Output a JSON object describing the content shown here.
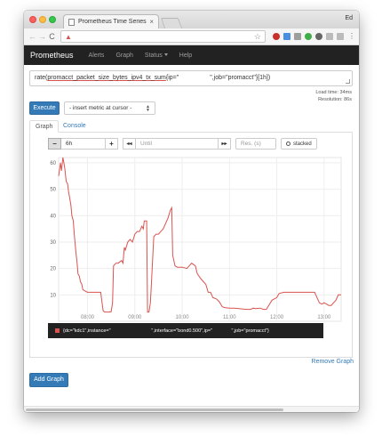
{
  "browser": {
    "tab_title": "Prometheus Time Series Colle",
    "tab_close": "×",
    "profile_name": "Ed",
    "nav": {
      "back": "←",
      "forward": "→",
      "reload": "C"
    },
    "security_icon": "warning-icon",
    "bookmark_icon": "star-icon"
  },
  "navbar": {
    "brand": "Prometheus",
    "links": [
      "Alerts",
      "Graph",
      "Status",
      "Help"
    ]
  },
  "query": {
    "expr_prefix": "rate(",
    "expr_metric": "promacct_packet_size_bytes_ipv4_tx_sum",
    "expr_label_start": "{ip=\"",
    "expr_gap": "                  ",
    "expr_suffix": "\",job=\"promacct\"}[1h])",
    "load_time": "Load time: 34ms",
    "resolution": "Resolution: 86s"
  },
  "actions": {
    "execute": "Execute",
    "metric_select": "- insert metric at cursor -",
    "remove_graph": "Remove Graph",
    "add_graph": "Add Graph"
  },
  "tabs": {
    "graph": "Graph",
    "console": "Console"
  },
  "controls": {
    "minus": "−",
    "range": "6h",
    "plus": "+",
    "back": "◂◂",
    "until_placeholder": "Until",
    "forward": "▸▸",
    "res_placeholder": "Res. (s)",
    "stacked": "stacked"
  },
  "legend": {
    "text": "{dc=\"kdc1\",instance=\"                              \",interface=\"bond0.500\",ip=\"              \",job=\"promacct\"}"
  },
  "colors": {
    "series": "#d9534f",
    "primary": "#337ab7",
    "navbar": "#222222"
  },
  "chart_data": {
    "type": "line",
    "title": "",
    "xlabel": "",
    "ylabel": "",
    "ylim": [
      0,
      62
    ],
    "yticks": [
      10,
      20,
      30,
      40,
      50,
      60
    ],
    "xlim": [
      7.39,
      13.36
    ],
    "xticks": [
      {
        "value": 8,
        "label": "08:00"
      },
      {
        "value": 9,
        "label": "09:00"
      },
      {
        "value": 10,
        "label": "10:00"
      },
      {
        "value": 11,
        "label": "11:00"
      },
      {
        "value": 12,
        "label": "12:00"
      },
      {
        "value": 13,
        "label": "13:00"
      }
    ],
    "grid": true,
    "series": [
      {
        "name": "",
        "color": "#d9534f",
        "points": [
          [
            7.39,
            55
          ],
          [
            7.43,
            60
          ],
          [
            7.45,
            57
          ],
          [
            7.48,
            62
          ],
          [
            7.5,
            60
          ],
          [
            7.52,
            58
          ],
          [
            7.55,
            53
          ],
          [
            7.58,
            52
          ],
          [
            7.6,
            49
          ],
          [
            7.62,
            47
          ],
          [
            7.65,
            44
          ],
          [
            7.67,
            40
          ],
          [
            7.7,
            38
          ],
          [
            7.72,
            33
          ],
          [
            7.75,
            27
          ],
          [
            7.78,
            22
          ],
          [
            7.8,
            18
          ],
          [
            7.83,
            17
          ],
          [
            7.85,
            15
          ],
          [
            7.88,
            14
          ],
          [
            7.9,
            12
          ],
          [
            7.95,
            11.5
          ],
          [
            8.0,
            11
          ],
          [
            8.1,
            11
          ],
          [
            8.2,
            11
          ],
          [
            8.28,
            11
          ],
          [
            8.3,
            8
          ],
          [
            8.33,
            4
          ],
          [
            8.36,
            3.5
          ],
          [
            8.45,
            3.5
          ],
          [
            8.5,
            3.6
          ],
          [
            8.53,
            7
          ],
          [
            8.55,
            21
          ],
          [
            8.6,
            22
          ],
          [
            8.65,
            22
          ],
          [
            8.72,
            23
          ],
          [
            8.75,
            22
          ],
          [
            8.78,
            28
          ],
          [
            8.8,
            27
          ],
          [
            8.85,
            30
          ],
          [
            8.9,
            31
          ],
          [
            8.95,
            30
          ],
          [
            9.0,
            33
          ],
          [
            9.05,
            34
          ],
          [
            9.1,
            34
          ],
          [
            9.15,
            36
          ],
          [
            9.18,
            35
          ],
          [
            9.2,
            38
          ],
          [
            9.25,
            38
          ],
          [
            9.27,
            3.5
          ],
          [
            9.3,
            3.5
          ],
          [
            9.33,
            7
          ],
          [
            9.35,
            14
          ],
          [
            9.4,
            32
          ],
          [
            9.45,
            33
          ],
          [
            9.5,
            33
          ],
          [
            9.55,
            34
          ],
          [
            9.6,
            35
          ],
          [
            9.65,
            37
          ],
          [
            9.7,
            39
          ],
          [
            9.75,
            42
          ],
          [
            9.78,
            43
          ],
          [
            9.8,
            25
          ],
          [
            9.85,
            21
          ],
          [
            9.9,
            20.5
          ],
          [
            10.0,
            20.5
          ],
          [
            10.1,
            20
          ],
          [
            10.15,
            21
          ],
          [
            10.2,
            22
          ],
          [
            10.28,
            21
          ],
          [
            10.32,
            18
          ],
          [
            10.4,
            16
          ],
          [
            10.5,
            14
          ],
          [
            10.55,
            11
          ],
          [
            10.6,
            11
          ],
          [
            10.65,
            9
          ],
          [
            10.72,
            8.5
          ],
          [
            10.78,
            7.5
          ],
          [
            10.85,
            5.5
          ],
          [
            10.9,
            5.2
          ],
          [
            11.0,
            5
          ],
          [
            11.1,
            5
          ],
          [
            11.2,
            4.8
          ],
          [
            11.35,
            4.5
          ],
          [
            11.45,
            4.5
          ],
          [
            11.5,
            5
          ],
          [
            11.55,
            4.8
          ],
          [
            11.65,
            5
          ],
          [
            11.72,
            4.5
          ],
          [
            11.78,
            4.5
          ],
          [
            11.83,
            6
          ],
          [
            11.9,
            8
          ],
          [
            12.0,
            9
          ],
          [
            12.05,
            10.5
          ],
          [
            12.15,
            11
          ],
          [
            12.25,
            11
          ],
          [
            12.4,
            11
          ],
          [
            12.55,
            11
          ],
          [
            12.7,
            11
          ],
          [
            12.8,
            11
          ],
          [
            12.85,
            9
          ],
          [
            12.9,
            7
          ],
          [
            12.95,
            6.5
          ],
          [
            13.0,
            7
          ],
          [
            13.05,
            6.5
          ],
          [
            13.1,
            6
          ],
          [
            13.15,
            6
          ],
          [
            13.2,
            7
          ],
          [
            13.25,
            8
          ],
          [
            13.3,
            10
          ],
          [
            13.36,
            10
          ]
        ]
      }
    ]
  }
}
